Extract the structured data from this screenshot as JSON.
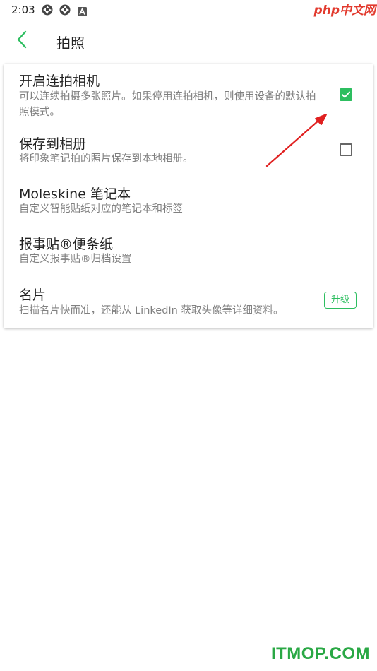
{
  "status_bar": {
    "time": "2:03",
    "icons": [
      "aperture-icon",
      "aperture-icon",
      "a-notification-icon"
    ]
  },
  "watermark_top": {
    "php": "php",
    "cn": "中文网"
  },
  "app_bar": {
    "back_icon": "chevron-left-icon",
    "title": "拍照"
  },
  "settings": {
    "burst_camera": {
      "title": "开启连拍相机",
      "subtitle": "可以连续拍摄多张照片。如果停用连拍相机，则使用设备的默认拍照模式。",
      "checked": true
    },
    "save_to_album": {
      "title": "保存到相册",
      "subtitle": "将印象笔记拍的照片保存到本地相册。",
      "checked": false
    },
    "moleskine": {
      "title": "Moleskine 笔记本",
      "subtitle": "自定义智能贴纸对应的笔记本和标签"
    },
    "post_it": {
      "title": "报事贴®便条纸",
      "subtitle": "自定义报事贴®归档设置"
    },
    "business_card": {
      "title": "名片",
      "subtitle": "扫描名片快而准，还能从 LinkedIn 获取头像等详细资料。",
      "upgrade_label": "升级"
    }
  },
  "colors": {
    "accent": "#2dbe60",
    "annotation_arrow": "#e02020",
    "watermark_bottom": "#2aa845"
  },
  "watermark_bottom": "ITMOP.COM"
}
